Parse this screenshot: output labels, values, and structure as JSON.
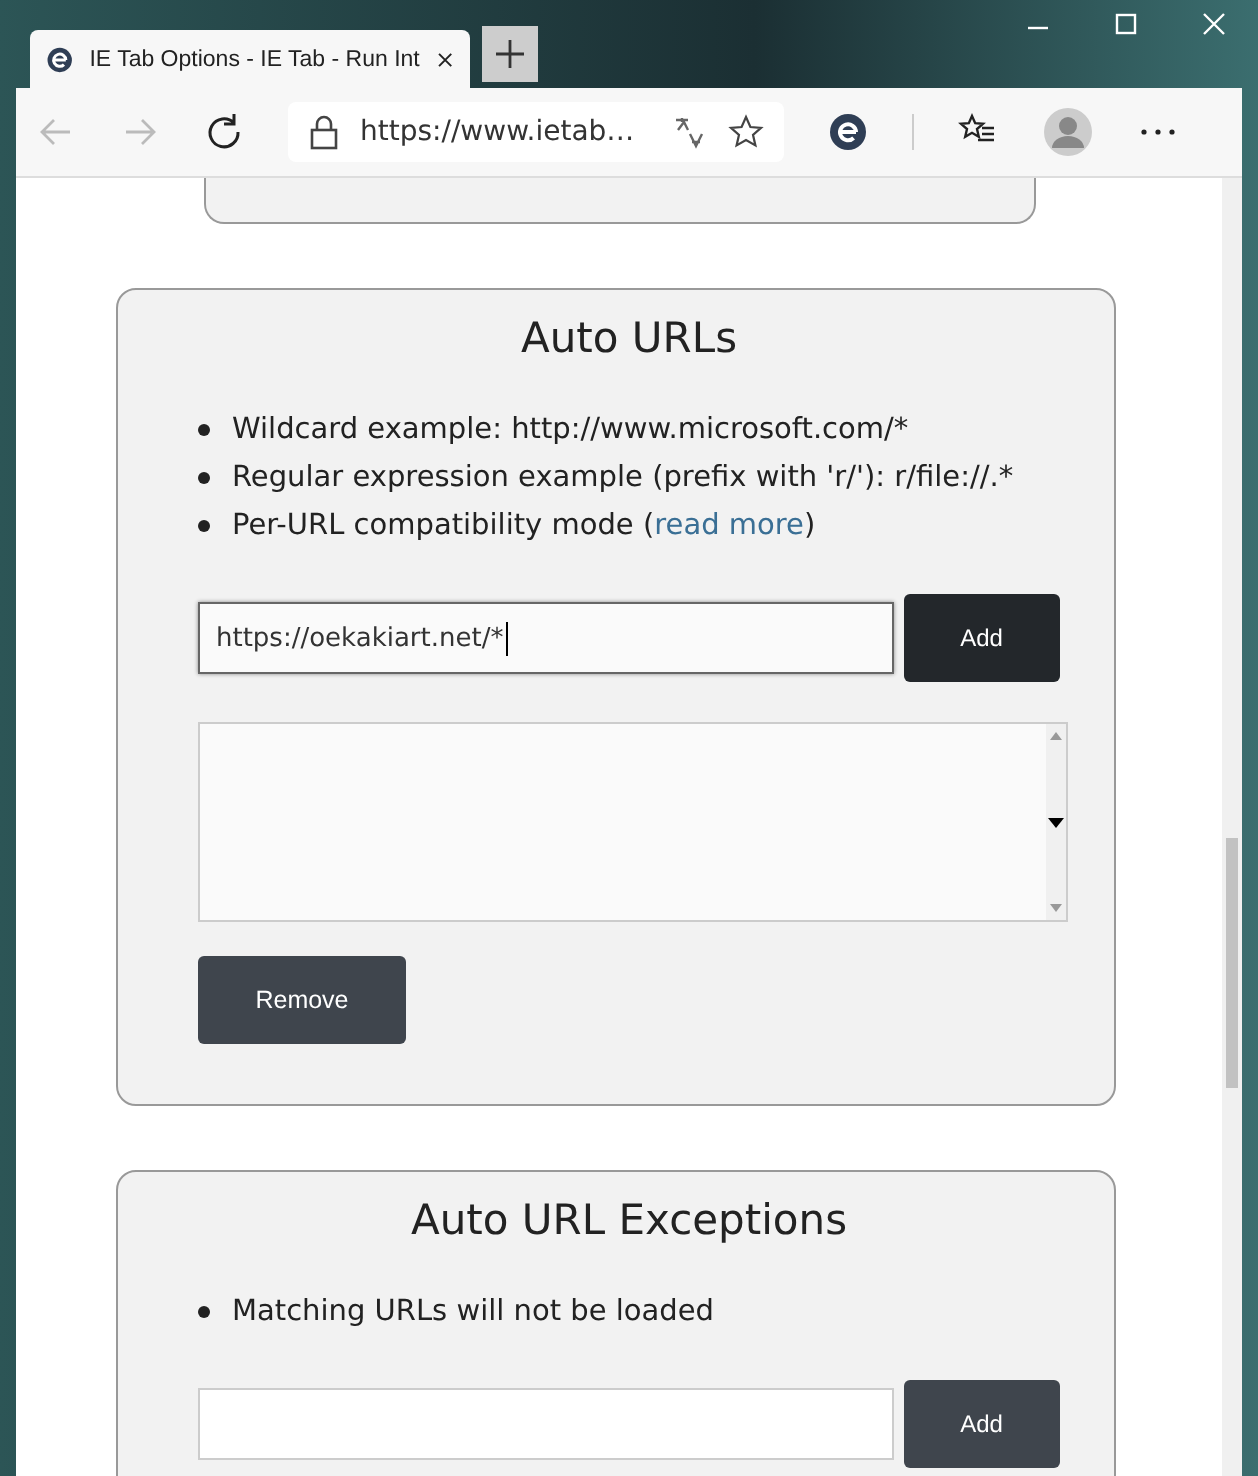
{
  "browser": {
    "tab": {
      "title": "IE Tab Options - IE Tab - Run Int",
      "selected": true
    },
    "address": "https://www.ietab…"
  },
  "sections": [
    {
      "title": "Auto URLs",
      "bullets": [
        {
          "text": "Wildcard example: http://www.microsoft.com/*"
        },
        {
          "text": "Regular expression example (prefix with 'r/'): r/file://.*"
        },
        {
          "text": "Per-URL compatibility mode (",
          "link": "read more",
          "after": ")"
        }
      ],
      "input": {
        "value": "https://oekakiart.net/*",
        "focused": true
      },
      "add_button": "Add",
      "remove_button": "Remove"
    },
    {
      "title": "Auto URL Exceptions",
      "bullets": [
        {
          "text": "Matching URLs will not be loaded"
        }
      ],
      "input": {
        "focused": false
      },
      "add_button": "Add"
    }
  ]
}
